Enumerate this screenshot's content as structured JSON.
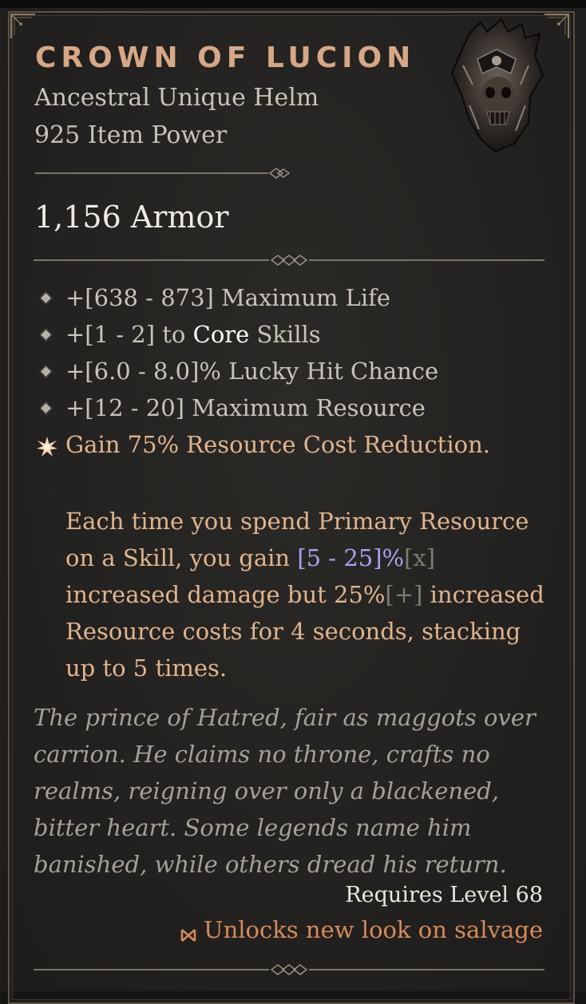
{
  "item": {
    "name": "CROWN OF LUCION",
    "type": "Ancestral Unique Helm",
    "item_power": "925 Item Power",
    "armor": "1,156 Armor"
  },
  "affixes": [
    {
      "prefix": "+[638 - 873] Maximum Life",
      "highlight": "",
      "suffix": ""
    },
    {
      "prefix": "+[1 - 2] to ",
      "highlight": "Core",
      "suffix": " Skills"
    },
    {
      "prefix": "+[6.0 - 8.0]% Lucky Hit Chance",
      "highlight": "",
      "suffix": ""
    },
    {
      "prefix": "+[12 - 20] Maximum Resource",
      "highlight": "",
      "suffix": ""
    }
  ],
  "unique": {
    "line": "Gain 75% Resource Cost Reduction.",
    "desc_1": "Each time you spend Primary Resource on a Skill, you gain ",
    "range": "[5 - 25]%",
    "tag_x": "[x]",
    "desc_2": " increased damage but 25%",
    "tag_plus": "[+]",
    "desc_3": " increased Resource costs for 4 seconds, stacking up to 5 times."
  },
  "flavor": "The prince of Hatred, fair as maggots over carrion. He claims no throne, crafts no realms, reigning over only a blackened, bitter heart. Some legends name him banished, while others dread his return.",
  "requirements": "Requires Level 68",
  "salvage": "Unlocks new look on salvage",
  "icons": {
    "helm": "helm-icon",
    "affix_bullet": "diamond-bullet-icon",
    "unique_affix": "unique-star-icon",
    "salvage": "transmog-icon"
  },
  "colors": {
    "title": "#d6a887",
    "unique_text": "#e0b48e",
    "range_text": "#a8a0f0",
    "salvage_text": "#d78a5c"
  }
}
